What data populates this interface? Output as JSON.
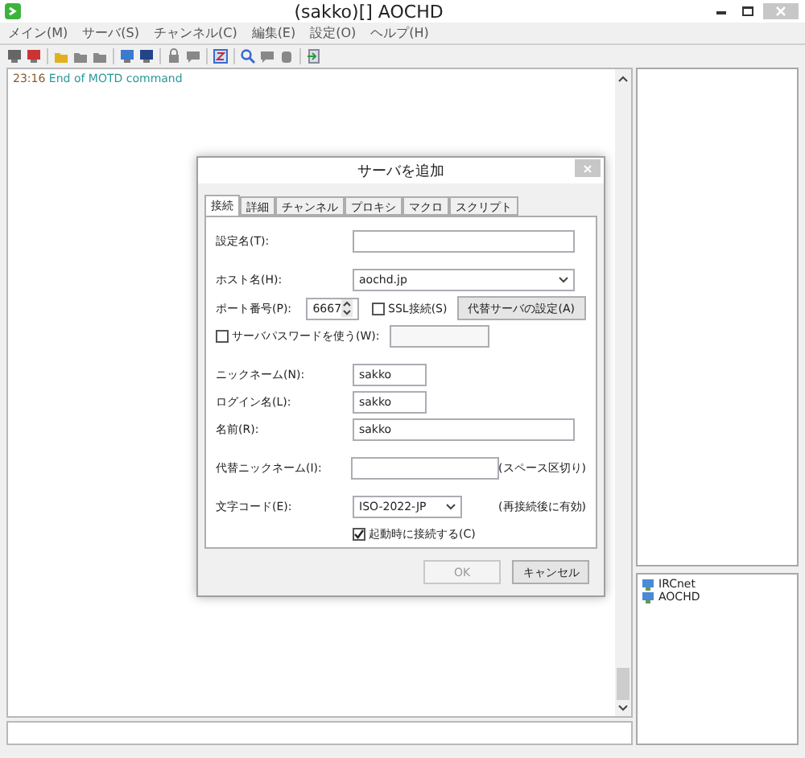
{
  "window": {
    "title": "(sakko)[] AOCHD"
  },
  "menu": [
    "メイン(M)",
    "サーバ(S)",
    "チャンネル(C)",
    "編集(E)",
    "設定(O)",
    "ヘルプ(H)"
  ],
  "log": [
    {
      "time": "23:16",
      "text": "End of MOTD command"
    }
  ],
  "server_tree": [
    {
      "label": "IRCnet"
    },
    {
      "label": "AOCHD"
    }
  ],
  "dialog": {
    "title": "サーバを追加",
    "tabs": [
      {
        "label": "接続",
        "selected": true
      },
      {
        "label": "詳細",
        "selected": false
      },
      {
        "label": "チャンネル",
        "selected": false
      },
      {
        "label": "プロキシ",
        "selected": false
      },
      {
        "label": "マクロ",
        "selected": false
      },
      {
        "label": "スクリプト",
        "selected": false
      }
    ],
    "groups": [
      [
        {
          "kind": "entry",
          "label": "設定名(T):"
        }
      ],
      [
        {
          "kind": "combo",
          "label": "ホスト名(H):",
          "value": "aochd.jp"
        },
        {
          "kind": "port",
          "label": "ポート番号(P):",
          "value": "6667",
          "ssl": {
            "label": "SSL接続(S)",
            "checked": false
          },
          "button": "代替サーバの設定(A)"
        },
        {
          "kind": "password",
          "label": "サーバパスワードを使う(W):",
          "checked": false
        }
      ],
      [
        {
          "kind": "short_entry",
          "label": "ニックネーム(N):",
          "value": "sakko"
        },
        {
          "kind": "short_entry",
          "label": "ログイン名(L):",
          "value": "sakko"
        },
        {
          "kind": "entry",
          "label": "名前(R):",
          "value": "sakko"
        }
      ],
      [
        {
          "kind": "note_entry",
          "label": "代替ニックネーム(I):",
          "note": "(スペース区切り)"
        }
      ],
      [
        {
          "kind": "note_combo",
          "label": "文字コード(E):",
          "value": "ISO-2022-JP",
          "note": "(再接続後に有効)"
        },
        {
          "kind": "checkbox",
          "label": "起動時に接続する(C)",
          "checked": true
        }
      ]
    ],
    "buttons": [
      {
        "label": "OK",
        "disabled": true
      },
      {
        "label": "キャンセル",
        "disabled": false
      }
    ]
  }
}
